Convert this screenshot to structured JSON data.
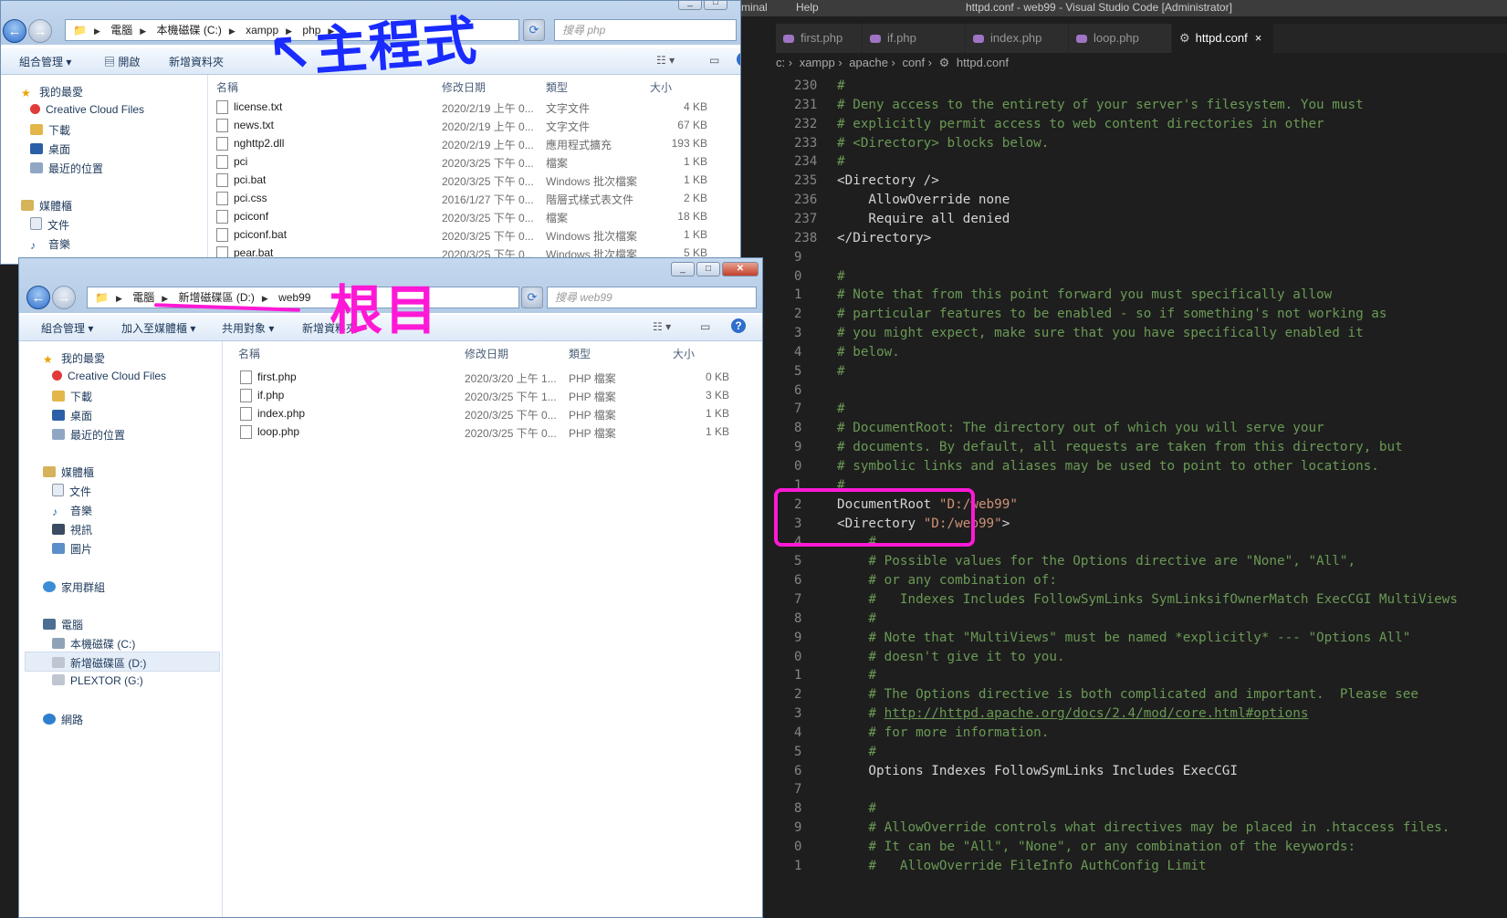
{
  "vscode": {
    "menu_terminal": "rminal",
    "menu_help": "Help",
    "window_title": "httpd.conf - web99 - Visual Studio Code [Administrator]",
    "tabs": [
      {
        "label": "first.php"
      },
      {
        "label": "if.php"
      },
      {
        "label": "index.php"
      },
      {
        "label": "loop.php"
      },
      {
        "label": "httpd.conf",
        "active": true,
        "close": "×"
      }
    ],
    "breadcrumb": [
      "c: ›",
      "xampp ›",
      "apache ›",
      "conf ›",
      "⚙",
      "httpd.conf"
    ],
    "lines": [
      {
        "n": "230",
        "t": "#"
      },
      {
        "n": "231",
        "t": "# Deny access to the entirety of your server's filesystem. You must"
      },
      {
        "n": "232",
        "t": "# explicitly permit access to web content directories in other"
      },
      {
        "n": "233",
        "t": "# <Directory> blocks below."
      },
      {
        "n": "234",
        "t": "#"
      },
      {
        "n": "235",
        "t": "<Directory />"
      },
      {
        "n": "236",
        "t": "    AllowOverride none"
      },
      {
        "n": "237",
        "t": "    Require all denied"
      },
      {
        "n": "238",
        "t": "</Directory>"
      },
      {
        "n": "9",
        "t": ""
      },
      {
        "n": "0",
        "t": "#"
      },
      {
        "n": "1",
        "t": "# Note that from this point forward you must specifically allow"
      },
      {
        "n": "2",
        "t": "# particular features to be enabled - so if something's not working as"
      },
      {
        "n": "3",
        "t": "# you might expect, make sure that you have specifically enabled it"
      },
      {
        "n": "4",
        "t": "# below."
      },
      {
        "n": "5",
        "t": "#"
      },
      {
        "n": "6",
        "t": ""
      },
      {
        "n": "7",
        "t": "#"
      },
      {
        "n": "8",
        "t": "# DocumentRoot: The directory out of which you will serve your"
      },
      {
        "n": "9",
        "t": "# documents. By default, all requests are taken from this directory, but"
      },
      {
        "n": "0",
        "t": "# symbolic links and aliases may be used to point to other locations."
      },
      {
        "n": "1",
        "t": "#"
      },
      {
        "n": "2",
        "t": "DocumentRoot \"D:/web99\""
      },
      {
        "n": "3",
        "t": "<Directory \"D:/web99\">"
      },
      {
        "n": "4",
        "t": "    #"
      },
      {
        "n": "5",
        "t": "    # Possible values for the Options directive are \"None\", \"All\","
      },
      {
        "n": "6",
        "t": "    # or any combination of:"
      },
      {
        "n": "7",
        "t": "    #   Indexes Includes FollowSymLinks SymLinksifOwnerMatch ExecCGI MultiViews"
      },
      {
        "n": "8",
        "t": "    #"
      },
      {
        "n": "9",
        "t": "    # Note that \"MultiViews\" must be named *explicitly* --- \"Options All\""
      },
      {
        "n": "0",
        "t": "    # doesn't give it to you."
      },
      {
        "n": "1",
        "t": "    #"
      },
      {
        "n": "2",
        "t": "    # The Options directive is both complicated and important.  Please see"
      },
      {
        "n": "3",
        "t": "    # http://httpd.apache.org/docs/2.4/mod/core.html#options"
      },
      {
        "n": "4",
        "t": "    # for more information."
      },
      {
        "n": "5",
        "t": "    #"
      },
      {
        "n": "6",
        "t": "    Options Indexes FollowSymLinks Includes ExecCGI"
      },
      {
        "n": "7",
        "t": ""
      },
      {
        "n": "8",
        "t": "    #"
      },
      {
        "n": "9",
        "t": "    # AllowOverride controls what directives may be placed in .htaccess files."
      },
      {
        "n": "0",
        "t": "    # It can be \"All\", \"None\", or any combination of the keywords:"
      },
      {
        "n": "1",
        "t": "    #   AllowOverride FileInfo AuthConfig Limit"
      }
    ]
  },
  "explorer_top": {
    "address": [
      "電腦",
      "本機磁碟 (C:)",
      "xampp",
      "php"
    ],
    "search_placeholder": "搜尋 php",
    "toolbar": {
      "organize": "組合管理 ▾",
      "open": "開啟",
      "new_folder": "新增資料夾"
    },
    "annotation": "↖主程式",
    "nav": [
      "我的最愛",
      "Creative Cloud Files",
      "下載",
      "桌面",
      "最近的位置",
      "媒體櫃",
      "文件",
      "音樂"
    ],
    "columns": {
      "name": "名稱",
      "date": "修改日期",
      "type": "類型",
      "size": "大小"
    },
    "files": [
      {
        "name": "license.txt",
        "date": "2020/2/19 上午 0...",
        "type": "文字文件",
        "size": "4 KB"
      },
      {
        "name": "news.txt",
        "date": "2020/2/19 上午 0...",
        "type": "文字文件",
        "size": "67 KB"
      },
      {
        "name": "nghttp2.dll",
        "date": "2020/2/19 上午 0...",
        "type": "應用程式擴充",
        "size": "193 KB"
      },
      {
        "name": "pci",
        "date": "2020/3/25 下午 0...",
        "type": "檔案",
        "size": "1 KB"
      },
      {
        "name": "pci.bat",
        "date": "2020/3/25 下午 0...",
        "type": "Windows 批次檔案",
        "size": "1 KB"
      },
      {
        "name": "pci.css",
        "date": "2016/1/27 下午 0...",
        "type": "階層式樣式表文件",
        "size": "2 KB"
      },
      {
        "name": "pciconf",
        "date": "2020/3/25 下午 0...",
        "type": "檔案",
        "size": "18 KB"
      },
      {
        "name": "pciconf.bat",
        "date": "2020/3/25 下午 0...",
        "type": "Windows 批次檔案",
        "size": "1 KB"
      },
      {
        "name": "pear.bat",
        "date": "2020/3/25 下午 0...",
        "type": "Windows 批次檔案",
        "size": "5 KB"
      }
    ]
  },
  "explorer_bottom": {
    "address": [
      "電腦",
      "新增磁碟區 (D:)",
      "web99"
    ],
    "search_placeholder": "搜尋 web99",
    "toolbar": {
      "organize": "組合管理 ▾",
      "add_library": "加入至媒體櫃 ▾",
      "share": "共用對象 ▾",
      "new_folder": "新增資料夾"
    },
    "annotation": "根目",
    "nav": {
      "favorites": "我的最愛",
      "creative_cloud": "Creative Cloud Files",
      "downloads": "下載",
      "desktop": "桌面",
      "recent": "最近的位置",
      "libraries": "媒體櫃",
      "documents": "文件",
      "music": "音樂",
      "videos": "視訊",
      "pictures": "圖片",
      "homegroup": "家用群組",
      "computer": "電腦",
      "drive_c": "本機磁碟 (C:)",
      "drive_d": "新增磁碟區 (D:)",
      "drive_g": "PLEXTOR (G:)",
      "network": "網路"
    },
    "columns": {
      "name": "名稱",
      "date": "修改日期",
      "type": "類型",
      "size": "大小"
    },
    "files": [
      {
        "name": "first.php",
        "date": "2020/3/20 上午 1...",
        "type": "PHP 檔案",
        "size": "0 KB"
      },
      {
        "name": "if.php",
        "date": "2020/3/25 下午 1...",
        "type": "PHP 檔案",
        "size": "3 KB"
      },
      {
        "name": "index.php",
        "date": "2020/3/25 下午 0...",
        "type": "PHP 檔案",
        "size": "1 KB"
      },
      {
        "name": "loop.php",
        "date": "2020/3/25 下午 0...",
        "type": "PHP 檔案",
        "size": "1 KB"
      }
    ]
  },
  "colors": {
    "annotation_blue": "#1a2bff",
    "annotation_magenta": "#ff19d6"
  }
}
